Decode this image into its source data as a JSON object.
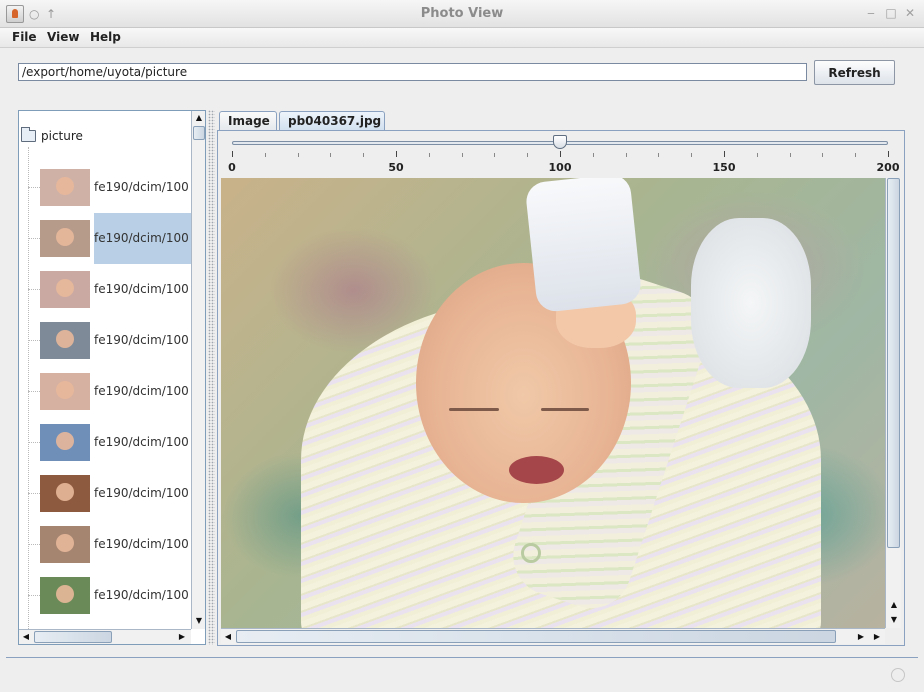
{
  "window": {
    "title": "Photo View",
    "controls": {
      "minimize": "‒",
      "maximize": "□",
      "close": "✕"
    },
    "extra_buttons": {
      "pin": "○",
      "up": "↑"
    }
  },
  "menubar": {
    "items": [
      {
        "label": "File"
      },
      {
        "label": "View"
      },
      {
        "label": "Help"
      }
    ]
  },
  "toolbar": {
    "path_value": "/export/home/uyota/picture",
    "refresh_label": "Refresh"
  },
  "tree": {
    "root_label": "picture",
    "items": [
      {
        "label": "fe190/dcim/100",
        "thumb_color": "#cfb1a6",
        "selected": false
      },
      {
        "label": "fe190/dcim/100",
        "thumb_color": "#b69a8a",
        "selected": true
      },
      {
        "label": "fe190/dcim/100",
        "thumb_color": "#c9a9a2",
        "selected": false
      },
      {
        "label": "fe190/dcim/100",
        "thumb_color": "#7f8a98",
        "selected": false
      },
      {
        "label": "fe190/dcim/100",
        "thumb_color": "#d6b0a0",
        "selected": false
      },
      {
        "label": "fe190/dcim/100",
        "thumb_color": "#6f8fb8",
        "selected": false
      },
      {
        "label": "fe190/dcim/100",
        "thumb_color": "#8e5a3f",
        "selected": false
      },
      {
        "label": "fe190/dcim/100",
        "thumb_color": "#a58570",
        "selected": false
      },
      {
        "label": "fe190/dcim/100",
        "thumb_color": "#6a8a58",
        "selected": false
      }
    ]
  },
  "tabs": [
    {
      "label": "Image",
      "active": false
    },
    {
      "label": "pb040367.jpg",
      "active": true
    }
  ],
  "zoom_slider": {
    "value": 100,
    "min": 0,
    "max": 200,
    "major_labels": [
      "0",
      "50",
      "100",
      "150",
      "200"
    ]
  },
  "colors": {
    "selection": "#b8cfe5",
    "border_accent": "#8aa2bf"
  }
}
